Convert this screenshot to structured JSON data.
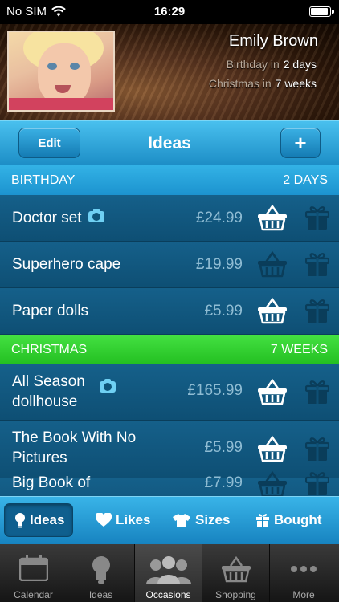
{
  "status": {
    "carrier": "No SIM",
    "time": "16:29",
    "battery_level": 0.95
  },
  "profile": {
    "name": "Emily Brown",
    "birthday_label": "Birthday in",
    "birthday_value": "2 days",
    "christmas_label": "Christmas in",
    "christmas_value": "7 weeks"
  },
  "navbar": {
    "edit_label": "Edit",
    "title": "Ideas",
    "add_label": "+"
  },
  "sections": [
    {
      "title": "BIRTHDAY",
      "countdown": "2 DAYS",
      "items": [
        {
          "name": "Doctor set",
          "price": "£24.99",
          "has_photo": true,
          "basket_active": true
        },
        {
          "name": "Superhero cape",
          "price": "£19.99",
          "has_photo": false,
          "basket_active": false
        },
        {
          "name": "Paper dolls",
          "price": "£5.99",
          "has_photo": false,
          "basket_active": true
        }
      ]
    },
    {
      "title": "CHRISTMAS",
      "countdown": "7 WEEKS",
      "items": [
        {
          "name_line1": "All Season",
          "name_line2": "dollhouse",
          "price": "£165.99",
          "has_photo": true,
          "basket_active": true
        },
        {
          "name_line1": "The Book With No",
          "name_line2": "Pictures",
          "price": "£5.99",
          "has_photo": false,
          "basket_active": true
        },
        {
          "name_line1": "Big Book of",
          "price": "£7.99",
          "has_photo": false,
          "basket_active": false
        }
      ]
    }
  ],
  "filter_tabs": [
    {
      "label": "Ideas",
      "icon": "lightbulb-icon",
      "selected": true
    },
    {
      "label": "Likes",
      "icon": "heart-icon",
      "selected": false
    },
    {
      "label": "Sizes",
      "icon": "tshirt-icon",
      "selected": false
    },
    {
      "label": "Bought",
      "icon": "gift-icon",
      "selected": false
    }
  ],
  "tabbar": [
    {
      "label": "Calendar",
      "icon": "calendar-icon",
      "active": false
    },
    {
      "label": "Ideas",
      "icon": "lightbulb-icon",
      "active": false
    },
    {
      "label": "Occasions",
      "icon": "people-icon",
      "active": true
    },
    {
      "label": "Shopping",
      "icon": "basket-icon",
      "active": false
    },
    {
      "label": "More",
      "icon": "more-dots-icon",
      "active": false
    }
  ],
  "colors": {
    "accent_blue": "#1c93cf",
    "christmas_green": "#23bf21",
    "row_bg": "#0e4f74",
    "price_text": "#8fbcd3"
  }
}
